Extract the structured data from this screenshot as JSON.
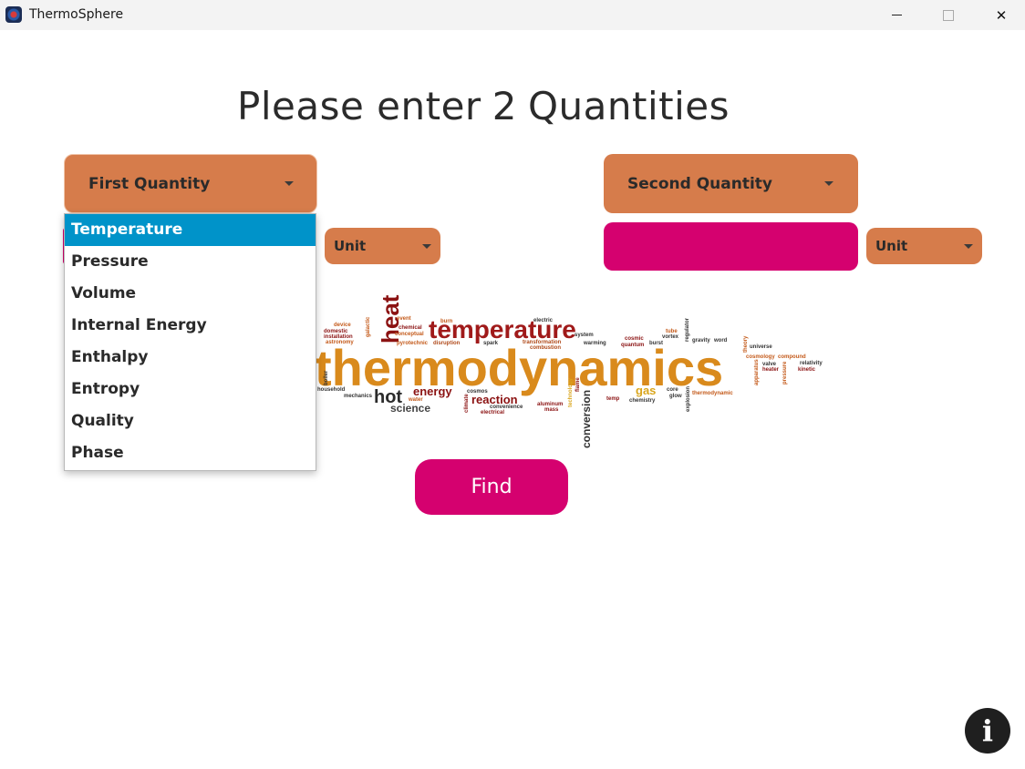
{
  "window": {
    "title": "ThermoSphere",
    "icon": "thermosphere-app-icon",
    "controls": [
      "minimize",
      "maximize",
      "close"
    ]
  },
  "heading": {
    "prefix": "Please enter",
    "count": "2",
    "suffix": "Quantities"
  },
  "first_quantity": {
    "label": "First Quantity",
    "unit_label": "Unit",
    "options": [
      "Temperature",
      "Pressure",
      "Volume",
      "Internal Energy",
      "Enthalpy",
      "Entropy",
      "Quality",
      "Phase"
    ],
    "highlighted": "Temperature"
  },
  "second_quantity": {
    "label": "Second Quantity",
    "unit_label": "Unit",
    "value": ""
  },
  "word_cloud": {
    "words": [
      "thermodynamics",
      "temperature",
      "heat",
      "hot",
      "science",
      "energy",
      "reaction",
      "conversion",
      "gas",
      "combustion",
      "transformation",
      "device",
      "domestic",
      "installation",
      "astronomy",
      "chemical",
      "conceptual",
      "pyrotechnic",
      "disruption",
      "spark",
      "electric",
      "warming",
      "system",
      "cosmic",
      "quantum",
      "burst",
      "tube",
      "vortex",
      "regulator",
      "gravity",
      "word",
      "theory",
      "universe",
      "cosmology",
      "compound",
      "valve",
      "heater",
      "relativity",
      "kinetic",
      "apparatus",
      "pressure",
      "core",
      "glow",
      "thermodynamic",
      "explosion",
      "temp",
      "chemistry",
      "mass",
      "aluminum",
      "convenience",
      "electrical",
      "cosmos",
      "climate",
      "water",
      "mechanics",
      "household",
      "boiler",
      "burn",
      "event",
      "galactic",
      "technology",
      "flame"
    ]
  },
  "actions": {
    "find_label": "Find",
    "info_label": "i"
  },
  "colors": {
    "combo_orange": "#d67c4b",
    "accent_pink": "#d5016f",
    "selection_blue": "#0093c9"
  }
}
